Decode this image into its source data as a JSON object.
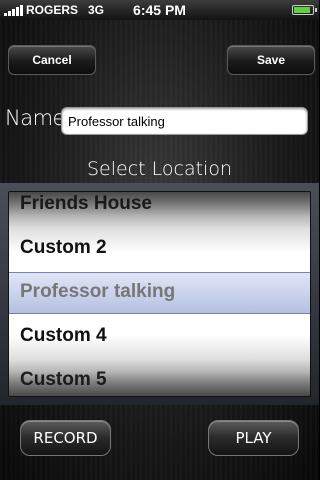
{
  "status_bar": {
    "carrier": "ROGERS",
    "network": "3G",
    "time": "6:45 PM",
    "battery_level": 0.9,
    "battery_color": "#5fd33d"
  },
  "toolbar": {
    "cancel_label": "Cancel",
    "save_label": "Save"
  },
  "form": {
    "name_label": "Name:",
    "name_value": "Professor talking",
    "select_title": "Select Location"
  },
  "picker": {
    "options": [
      "Friends House",
      "Custom 2",
      "Professor talking",
      "Custom 4",
      "Custom 5"
    ],
    "selected": "Professor talking"
  },
  "controls": {
    "record_label": "RECORD",
    "play_label": "PLAY"
  }
}
